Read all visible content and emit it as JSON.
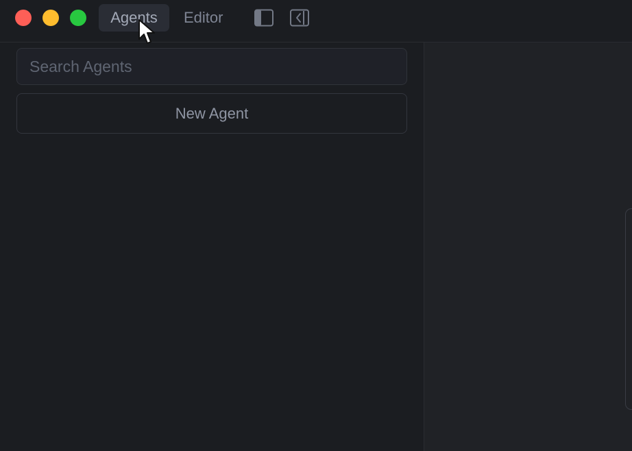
{
  "window": {
    "traffic_lights": {
      "close_color": "#fe5f57",
      "minimize_color": "#febc2e",
      "maximize_color": "#28c840"
    }
  },
  "header": {
    "tabs": [
      {
        "label": "Agents",
        "active": true
      },
      {
        "label": "Editor",
        "active": false
      }
    ],
    "icons": {
      "sidebar_toggle": "sidebar-toggle-icon",
      "collapse_panel": "collapse-panel-icon"
    }
  },
  "sidebar": {
    "search": {
      "value": "",
      "placeholder": "Search Agents"
    },
    "new_agent_label": "New Agent"
  },
  "theme": {
    "background": "#1b1d21",
    "panel": "#202226",
    "border": "#2a2c31",
    "text": "#8f95a3"
  },
  "cursor": "pointer-arrow-icon"
}
